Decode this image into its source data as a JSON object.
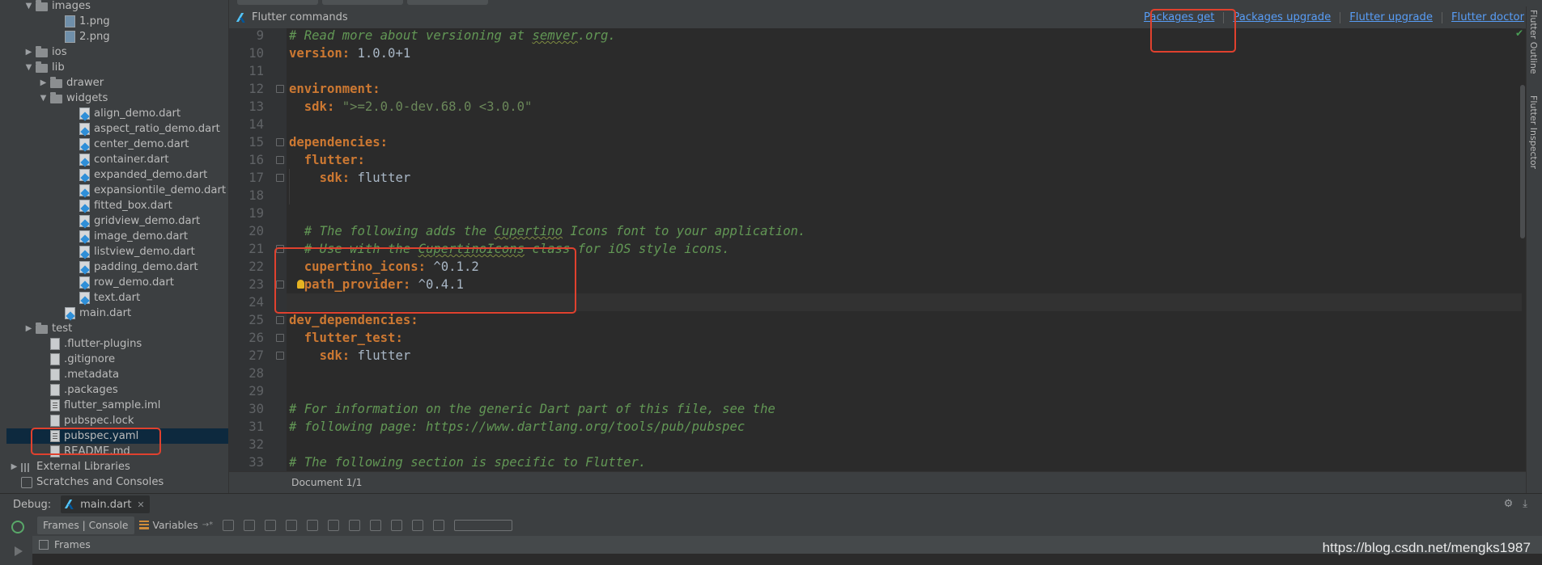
{
  "project_tree": [
    {
      "name": "images",
      "depth": 1,
      "type": "folder",
      "expanded": true,
      "partial": true
    },
    {
      "name": "1.png",
      "depth": 3,
      "type": "png"
    },
    {
      "name": "2.png",
      "depth": 3,
      "type": "png"
    },
    {
      "name": "ios",
      "depth": 1,
      "type": "folder",
      "expanded": false
    },
    {
      "name": "lib",
      "depth": 1,
      "type": "folder",
      "expanded": true
    },
    {
      "name": "drawer",
      "depth": 2,
      "type": "folder",
      "expanded": false
    },
    {
      "name": "widgets",
      "depth": 2,
      "type": "folder",
      "expanded": true
    },
    {
      "name": "align_demo.dart",
      "depth": 4,
      "type": "dart"
    },
    {
      "name": "aspect_ratio_demo.dart",
      "depth": 4,
      "type": "dart"
    },
    {
      "name": "center_demo.dart",
      "depth": 4,
      "type": "dart"
    },
    {
      "name": "container.dart",
      "depth": 4,
      "type": "dart"
    },
    {
      "name": "expanded_demo.dart",
      "depth": 4,
      "type": "dart"
    },
    {
      "name": "expansiontile_demo.dart",
      "depth": 4,
      "type": "dart"
    },
    {
      "name": "fitted_box.dart",
      "depth": 4,
      "type": "dart"
    },
    {
      "name": "gridview_demo.dart",
      "depth": 4,
      "type": "dart"
    },
    {
      "name": "image_demo.dart",
      "depth": 4,
      "type": "dart"
    },
    {
      "name": "listview_demo.dart",
      "depth": 4,
      "type": "dart"
    },
    {
      "name": "padding_demo.dart",
      "depth": 4,
      "type": "dart"
    },
    {
      "name": "row_demo.dart",
      "depth": 4,
      "type": "dart"
    },
    {
      "name": "text.dart",
      "depth": 4,
      "type": "dart"
    },
    {
      "name": "main.dart",
      "depth": 3,
      "type": "dart"
    },
    {
      "name": "test",
      "depth": 1,
      "type": "folder",
      "expanded": false
    },
    {
      "name": ".flutter-plugins",
      "depth": 2,
      "type": "plain"
    },
    {
      "name": ".gitignore",
      "depth": 2,
      "type": "plain"
    },
    {
      "name": ".metadata",
      "depth": 2,
      "type": "plain"
    },
    {
      "name": ".packages",
      "depth": 2,
      "type": "plain"
    },
    {
      "name": "flutter_sample.iml",
      "depth": 2,
      "type": "yaml"
    },
    {
      "name": "pubspec.lock",
      "depth": 2,
      "type": "plain"
    },
    {
      "name": "pubspec.yaml",
      "depth": 2,
      "type": "yaml",
      "selected": true
    },
    {
      "name": "README.md",
      "depth": 2,
      "type": "plain"
    },
    {
      "name": "External Libraries",
      "depth": 0,
      "type": "lib",
      "expanded": false
    },
    {
      "name": "Scratches and Consoles",
      "depth": 0,
      "type": "scratch"
    }
  ],
  "flutter_commands": {
    "title": "Flutter commands",
    "links": [
      "Packages get",
      "Packages upgrade",
      "Flutter upgrade",
      "Flutter doctor"
    ]
  },
  "editor": {
    "lines": [
      {
        "n": "9",
        "parts": [
          {
            "c": "com",
            "t": "# Read more about versioning at "
          },
          {
            "c": "com wavy",
            "t": "semver"
          },
          {
            "c": "com",
            "t": ".org."
          }
        ]
      },
      {
        "n": "10",
        "parts": [
          {
            "c": "key",
            "t": "version:"
          },
          {
            "c": "val",
            "t": " 1.0.0+1"
          }
        ]
      },
      {
        "n": "11",
        "parts": []
      },
      {
        "n": "12",
        "parts": [
          {
            "c": "key",
            "t": "environment:"
          }
        ]
      },
      {
        "n": "13",
        "parts": [
          {
            "c": "val",
            "t": "  "
          },
          {
            "c": "key",
            "t": "sdk:"
          },
          {
            "c": "val",
            "t": " "
          },
          {
            "c": "str",
            "t": "\">=2.0.0-dev.68.0 <3.0.0\""
          }
        ]
      },
      {
        "n": "14",
        "parts": []
      },
      {
        "n": "15",
        "parts": [
          {
            "c": "key",
            "t": "dependencies:"
          }
        ]
      },
      {
        "n": "16",
        "parts": [
          {
            "c": "val",
            "t": "  "
          },
          {
            "c": "key",
            "t": "flutter:"
          }
        ]
      },
      {
        "n": "17",
        "parts": [
          {
            "c": "val",
            "t": "    "
          },
          {
            "c": "key",
            "t": "sdk:"
          },
          {
            "c": "val",
            "t": " flutter"
          }
        ]
      },
      {
        "n": "18",
        "parts": []
      },
      {
        "n": "19",
        "parts": []
      },
      {
        "n": "20",
        "parts": [
          {
            "c": "com",
            "t": "  # The following adds the "
          },
          {
            "c": "com wavy",
            "t": "Cupertino"
          },
          {
            "c": "com",
            "t": " Icons font to your application."
          }
        ]
      },
      {
        "n": "21",
        "parts": [
          {
            "c": "com",
            "t": "  # Use with the "
          },
          {
            "c": "com wavy",
            "t": "CupertinoIcons"
          },
          {
            "c": "com",
            "t": " class for iOS style icons."
          }
        ]
      },
      {
        "n": "22",
        "parts": [
          {
            "c": "val",
            "t": "  "
          },
          {
            "c": "key",
            "t": "cupertino_icons:"
          },
          {
            "c": "val",
            "t": " ^0.1.2"
          }
        ]
      },
      {
        "n": "23",
        "parts": [
          {
            "c": "val",
            "t": "  "
          },
          {
            "c": "key",
            "t": "path_provider:"
          },
          {
            "c": "val",
            "t": " ^0.4.1"
          }
        ],
        "bulb": true
      },
      {
        "n": "24",
        "parts": [],
        "current": true
      },
      {
        "n": "25",
        "parts": [
          {
            "c": "key",
            "t": "dev_dependencies:"
          }
        ]
      },
      {
        "n": "26",
        "parts": [
          {
            "c": "val",
            "t": "  "
          },
          {
            "c": "key",
            "t": "flutter_test:"
          }
        ]
      },
      {
        "n": "27",
        "parts": [
          {
            "c": "val",
            "t": "    "
          },
          {
            "c": "key",
            "t": "sdk:"
          },
          {
            "c": "val",
            "t": " flutter"
          }
        ]
      },
      {
        "n": "28",
        "parts": []
      },
      {
        "n": "29",
        "parts": []
      },
      {
        "n": "30",
        "parts": [
          {
            "c": "com",
            "t": "# For information on the generic Dart part of this file, see the"
          }
        ]
      },
      {
        "n": "31",
        "parts": [
          {
            "c": "com",
            "t": "# following page: https://www.dartlang.org/tools/pub/pubspec"
          }
        ]
      },
      {
        "n": "32",
        "parts": []
      },
      {
        "n": "33",
        "parts": [
          {
            "c": "com",
            "t": "# The following section is specific to Flutter."
          }
        ]
      }
    ],
    "status": "Document 1/1"
  },
  "right_strip": [
    "Flutter Outline",
    "Flutter Inspector"
  ],
  "debug": {
    "label": "Debug:",
    "tab": "main.dart",
    "tool_tabs": [
      "Frames | Console",
      "Variables"
    ],
    "frames_label": "Frames"
  },
  "watermark": "https://blog.csdn.net/mengks1987",
  "colors": {
    "highlight": "#e0412e",
    "link": "#589df6",
    "keyword": "#cc7832",
    "comment": "#629755"
  }
}
